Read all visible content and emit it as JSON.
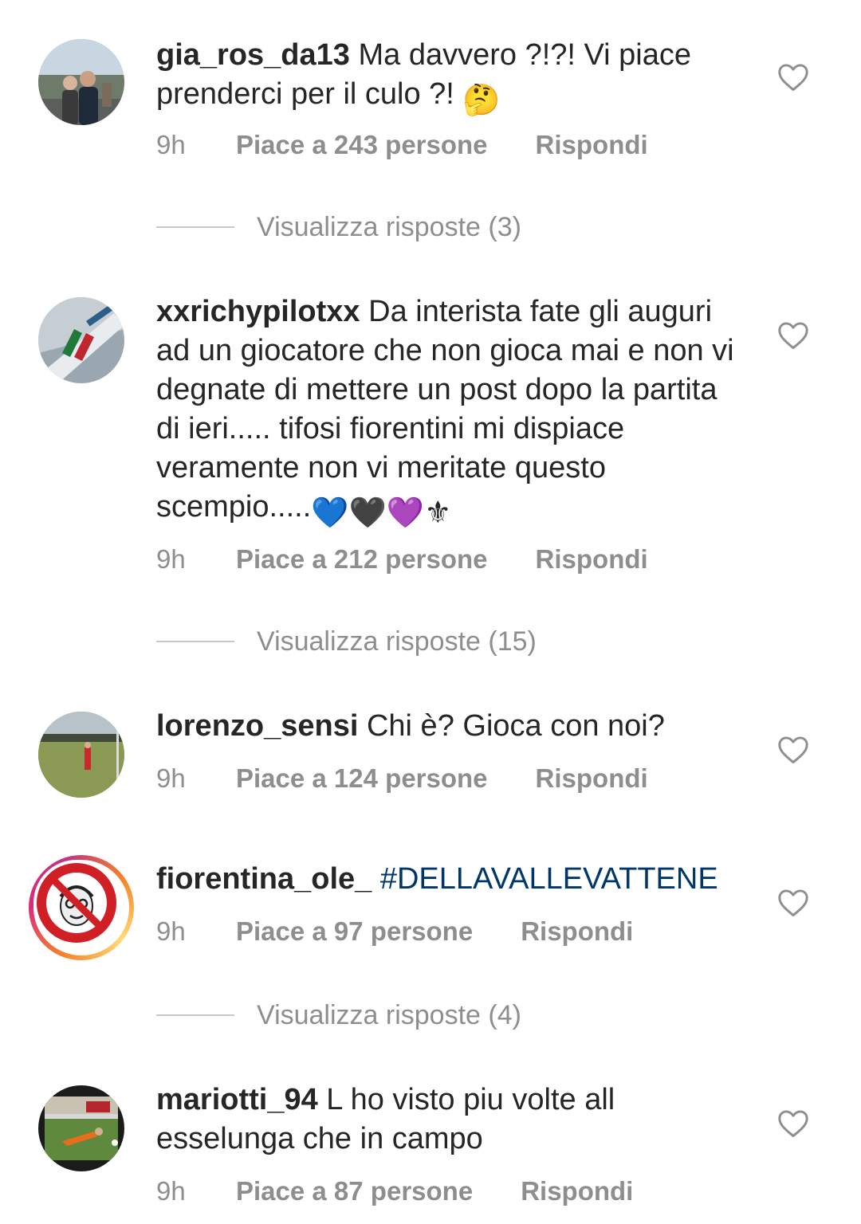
{
  "comments": [
    {
      "username": "gia_ros_da13",
      "text": " Ma davvero ?!?! Vi piace prenderci per il culo ?! ",
      "emoji": "🤔",
      "time": "9h",
      "likes": "Piace a 243 persone",
      "reply": "Rispondi",
      "view_replies": "Visualizza risposte (3)"
    },
    {
      "username": "xxrichypilotxx",
      "text": " Da interista fate gli auguri ad un giocatore che non gioca mai e non vi degnate di mettere un post dopo la partita di ieri..... tifosi fiorentini mi dispiace veramente non vi meritate questo scempio.....",
      "emoji": "💙🖤💜⚜",
      "time": "9h",
      "likes": "Piace a 212 persone",
      "reply": "Rispondi",
      "view_replies": "Visualizza risposte (15)"
    },
    {
      "username": "lorenzo_sensi",
      "text": " Chi è? Gioca con noi?",
      "time": "9h",
      "likes": "Piace a 124 persone",
      "reply": "Rispondi"
    },
    {
      "username": "fiorentina_ole_",
      "hashtag": "#DELLAVALLEVATTENE",
      "time": "9h",
      "likes": "Piace a 97 persone",
      "reply": "Rispondi",
      "view_replies": "Visualizza risposte (4)"
    },
    {
      "username": "mariotti_94",
      "text": " L ho visto piu volte all esselunga che in campo",
      "time": "9h",
      "likes": "Piace a 87 persone",
      "reply": "Rispondi"
    }
  ],
  "icons": {
    "like": "heart-outline-icon",
    "story_ring": "story-ring"
  },
  "colors": {
    "text": "#262626",
    "secondary": "#8e8e8e",
    "hashtag": "#00376b",
    "divider": "#c7c7c7"
  }
}
